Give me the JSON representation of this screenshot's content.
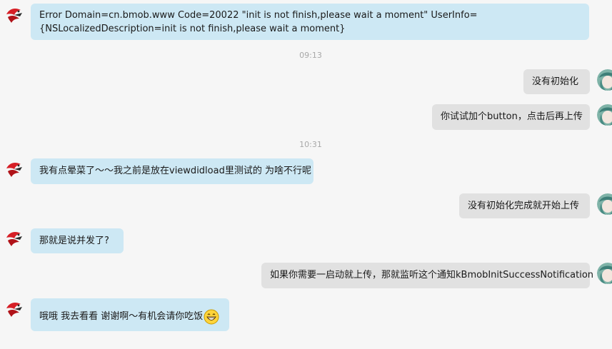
{
  "messages": [
    {
      "side": "in",
      "text": "Error Domain=cn.bmob.www Code=20022 \"init is not finish,please wait a moment\" UserInfo={NSLocalizedDescription=init is not finish,please wait a moment}"
    },
    {
      "time": "09:13"
    },
    {
      "side": "out",
      "text": "没有初始化"
    },
    {
      "side": "out",
      "text": "你试试加个button，点击后再上传"
    },
    {
      "time": "10:31"
    },
    {
      "side": "in",
      "text": "我有点晕菜了～～我之前是放在viewdidload里测试的 为啥不行呢"
    },
    {
      "side": "out",
      "text": "没有初始化完成就开始上传"
    },
    {
      "side": "in",
      "text": "那就是说并发了?"
    },
    {
      "side": "out",
      "text": "如果你需要一启动就上传，那就监听这个通知kBmobInitSuccessNotification"
    },
    {
      "side": "in",
      "text": "哦哦 我去看看 谢谢啊～有机会请你吃饭"
    }
  ],
  "icons": {
    "incoming_avatar": "bird-logo-icon",
    "outgoing_avatar": "anime-girl-avatar-icon",
    "emoji": "grinning-emoji-icon"
  },
  "colors": {
    "incoming_bubble": "#cde8f4",
    "outgoing_bubble": "#e1e1e1",
    "background": "#f6f6f6",
    "timestamp": "#a8a8a8"
  }
}
